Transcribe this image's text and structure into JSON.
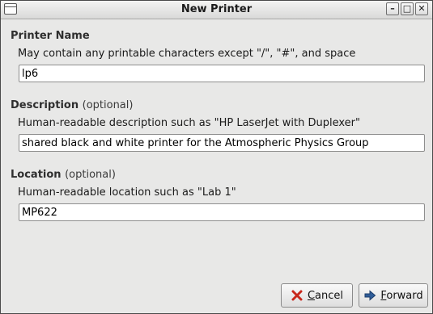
{
  "window": {
    "title": "New Printer",
    "controls": {
      "minimize": "–",
      "maximize": "□",
      "close": "✕"
    }
  },
  "sections": {
    "name": {
      "heading": "Printer Name",
      "optional": "",
      "hint": "May contain any printable characters except \"/\", \"#\", and space",
      "value": "lp6"
    },
    "description": {
      "heading": "Description",
      "optional": "(optional)",
      "hint": "Human-readable description such as \"HP LaserJet with Duplexer\"",
      "value": "shared black and white printer for the Atmospheric Physics Group"
    },
    "location": {
      "heading": "Location",
      "optional": "(optional)",
      "hint": "Human-readable location such as \"Lab 1\"",
      "value": "MP622"
    }
  },
  "buttons": {
    "cancel": {
      "label": "Cancel",
      "icon": "red-x-icon"
    },
    "forward": {
      "label": "Forward",
      "icon": "right-arrow-icon"
    }
  },
  "colors": {
    "cancel_icon": "#c8281c",
    "forward_icon": "#2f5d99"
  }
}
